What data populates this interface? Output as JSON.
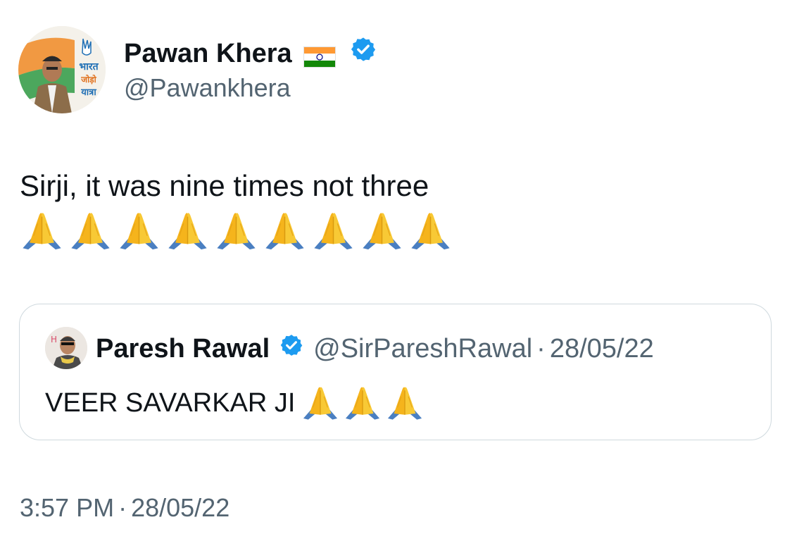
{
  "author": {
    "name": "Pawan Khera",
    "handle": "@Pawankhera",
    "flag_icon": "india-flag-icon",
    "verified_icon": "verified-badge-icon",
    "avatar_text": "भारत जोड़ो यात्रा"
  },
  "tweet": {
    "text": "Sirji, it was nine times not three",
    "emoji_name": "folded-hands-emoji",
    "emoji_count": 9
  },
  "quoted": {
    "name": "Paresh Rawal",
    "handle": "@SirPareshRawal",
    "separator": "·",
    "date": "28/05/22",
    "text": "VEER SAVARKAR JI",
    "emoji_count": 3
  },
  "timestamp": {
    "time": "3:57 PM",
    "separator": "·",
    "date": "28/05/22"
  },
  "colors": {
    "text": "#0f1419",
    "secondary": "#536471",
    "verified": "#1d9bf0",
    "border": "#cfd9de"
  }
}
